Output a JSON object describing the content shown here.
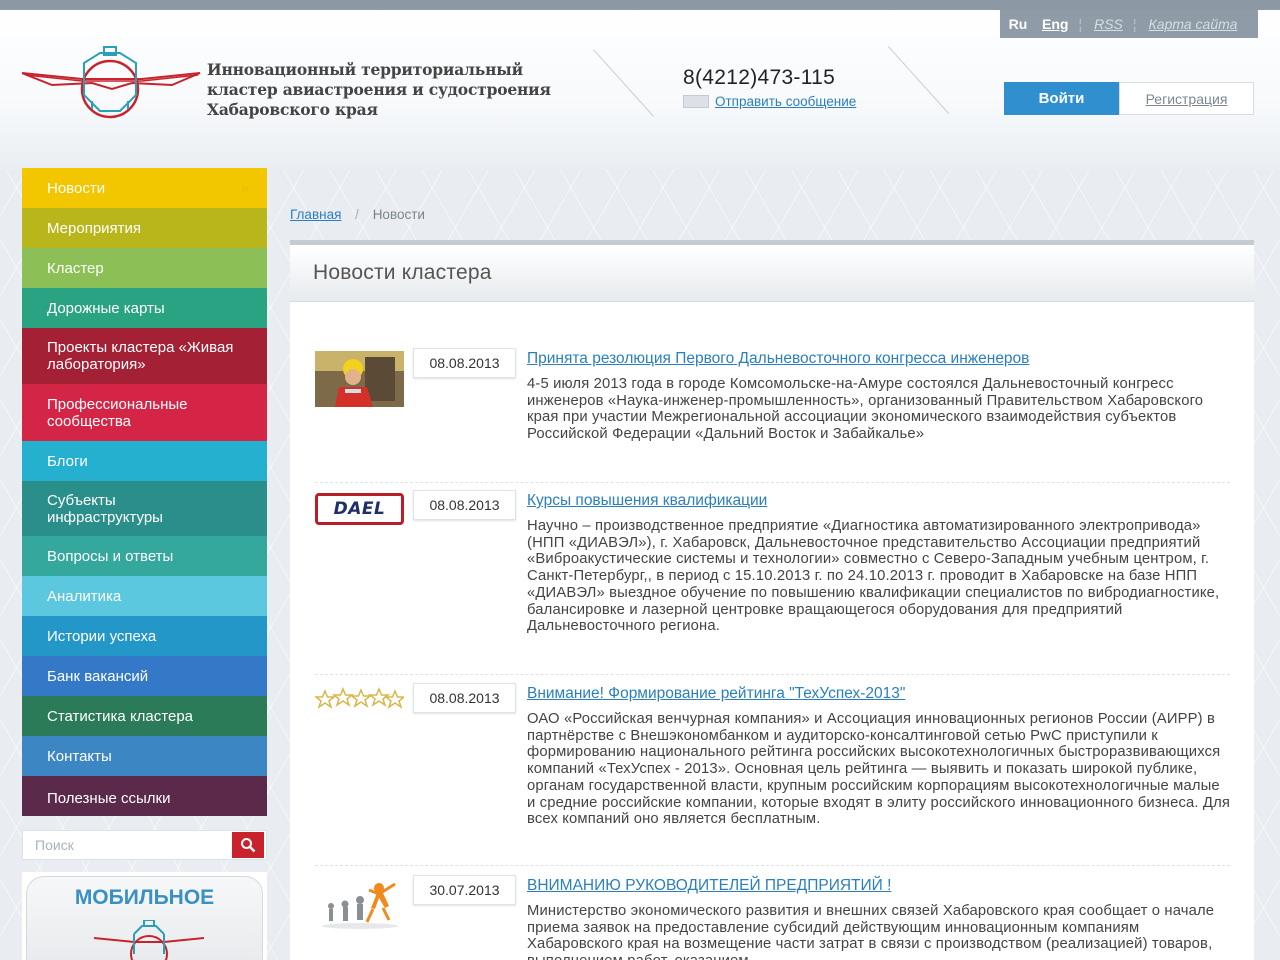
{
  "header": {
    "lang_ru": "Ru",
    "lang_en": "Eng",
    "rss": "RSS",
    "site_map": "Карта сайта",
    "logo_line1": "Инновационный территориальный",
    "logo_line2": "кластер авиастроения и судостроения",
    "logo_line3": "Хабаровского края",
    "phone": "8(4212)473-115",
    "send_message": "Отправить сообщение",
    "login": "Войти",
    "register": "Регистрация"
  },
  "sidebar": {
    "items": [
      {
        "label": "Новости",
        "color": "#f2c700"
      },
      {
        "label": "Мероприятия",
        "color": "#b8b61a"
      },
      {
        "label": "Кластер",
        "color": "#8cbf55"
      },
      {
        "label": "Дорожные карты",
        "color": "#2aa383"
      },
      {
        "label": "Проекты кластера «Живая лаборатория»",
        "color": "#a32035"
      },
      {
        "label": "Профессиональные сообщества",
        "color": "#d52546"
      },
      {
        "label": "Блоги",
        "color": "#26b0cf"
      },
      {
        "label": "Субъекты инфраструктуры",
        "color": "#2a8f8a"
      },
      {
        "label": "Вопросы и ответы",
        "color": "#35a89e"
      },
      {
        "label": "Аналитика",
        "color": "#5cc8df"
      },
      {
        "label": "Истории успеха",
        "color": "#2497c9"
      },
      {
        "label": "Банк вакансий",
        "color": "#3479c8"
      },
      {
        "label": "Статистика кластера",
        "color": "#2b7a58"
      },
      {
        "label": "Контакты",
        "color": "#3d86c4"
      },
      {
        "label": "Полезные ссылки",
        "color": "#5b2a4b"
      }
    ],
    "search_placeholder": "Поиск",
    "mobile_label": "МОБИЛЬНОЕ"
  },
  "breadcrumb": {
    "home": "Главная",
    "separator": "/",
    "current": "Новости"
  },
  "main": {
    "title": "Новости кластера",
    "news": [
      {
        "date": "08.08.2013",
        "title": "Принята резолюция Первого Дальневосточного конгресса инженеров",
        "text": "4-5 июля 2013 года в городе Комсомольске-на-Амуре состоялся Дальневосточный конгресс инженеров «Наука-инженер-промышленность», организованный Правительством Хабаровского края при участии Межрегиональной ассоциации экономического взаимодействия субъектов Российской Федерации «Дальний Восток и Забайкалье»",
        "thumb": "engineer-photo"
      },
      {
        "date": "08.08.2013",
        "title": "Курсы повышения квалификации",
        "text": "Научно – производственное предприятие «Диагностика автоматизированного электропривода» (НПП «ДИАВЭЛ»), г. Хабаровск, Дальневосточное представительство Ассоциации предприятий «Виброакустические системы и технологии» совместно с Северо-Западным учебным центром, г. Санкт-Петербург,, в период с 15.10.2013 г. по 24.10.2013 г. проводит в Хабаровске на базе НПП «ДИАВЭЛ» выездное обучение по повышению квалификации специалистов по вибродиагностике, балансировке и лазерной центровке вращающегося оборудования для предприятий Дальневосточного региона.",
        "thumb": "dael-logo",
        "thumb_text": "DAEL"
      },
      {
        "date": "08.08.2013",
        "title": "Внимание! Формирование рейтинга \"ТехУспех-2013\"",
        "text": "ОАО «Российская венчурная компания» и Ассоциация инновационных регионов России (АИРР) в партнёрстве с Внешэкономбанком и аудиторско-консалтинговой сетью PwC приступили к формированию национального рейтинга российских высокотехнологичных быстроразвивающихся компаний «ТехУспех - 2013». Основная цель рейтинга — выявить и показать широкой публике, органам государственной власти, крупным российским корпорациям высокотехнологичные малые и средние российские компании, которые входят в элиту российского инновационного бизнеса. Для всех компаний оно является бесплатным.",
        "thumb": "stars-image"
      },
      {
        "date": "30.07.2013",
        "title": "ВНИМАНИЮ РУКОВОДИТЕЛЕЙ ПРЕДПРИЯТИЙ !",
        "text": "Министерство экономического развития и внешних связей Хабаровского края сообщает о начале приема заявок на предоставление субсидий действующим инновационным компаниям Хабаровского края на возмещение части затрат в связи с производством (реализацией) товаров, выполнением работ, оказанием",
        "thumb": "runners-image"
      }
    ]
  }
}
